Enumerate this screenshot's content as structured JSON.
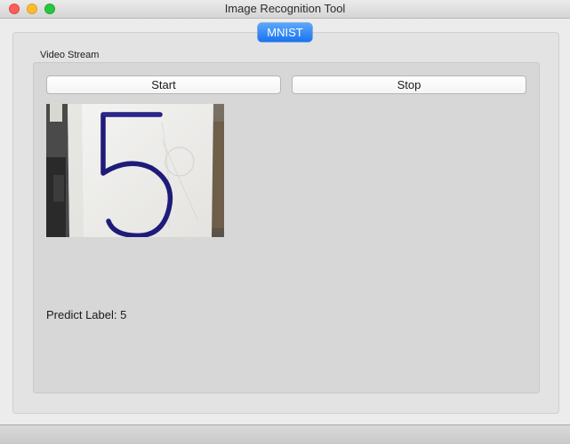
{
  "window": {
    "title": "Image Recognition Tool"
  },
  "tabs": [
    {
      "label": "MNIST",
      "selected": true
    }
  ],
  "video_group": {
    "label": "Video Stream",
    "start_label": "Start",
    "stop_label": "Stop",
    "frame_digit": "5",
    "frame_description_icon": "webcam-frame"
  },
  "prediction": {
    "label": "Predict Label:",
    "value": "5"
  },
  "colors": {
    "accent": "#1a73f0",
    "close": "#fc5f57",
    "minimize": "#fdbc2e",
    "maximize": "#29c840",
    "ink": "#1e1b7a"
  }
}
